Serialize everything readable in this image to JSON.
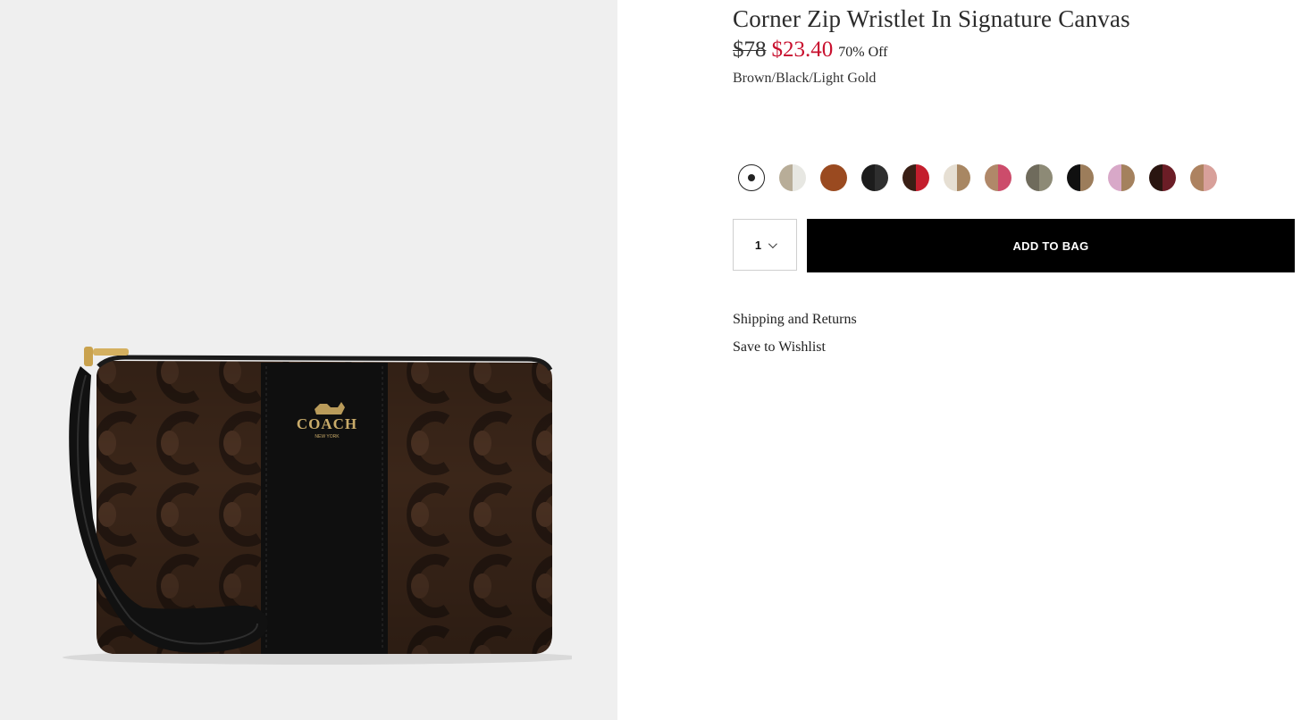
{
  "product": {
    "title": "Corner Zip Wristlet In Signature Canvas",
    "price_original": "$78",
    "price_sale": "$23.40",
    "discount": "70% Off",
    "color_name": "Brown/Black/Light Gold",
    "image_logo_text": "COACH",
    "image_logo_subtext": "NEW YORK"
  },
  "swatches": [
    {
      "name": "Brown/Black",
      "selected": true,
      "colors": [
        "#ffffff"
      ]
    },
    {
      "name": "swatch-2",
      "selected": false,
      "colors": [
        "#b8ad98",
        "#e7e7e2"
      ]
    },
    {
      "name": "swatch-3",
      "selected": false,
      "colors": [
        "#9a4a20",
        "#9a4a20"
      ]
    },
    {
      "name": "swatch-4",
      "selected": false,
      "colors": [
        "#1c1c1c",
        "#2f2f2f"
      ]
    },
    {
      "name": "swatch-5",
      "selected": false,
      "colors": [
        "#3a1f15",
        "#c41e2d"
      ]
    },
    {
      "name": "swatch-6",
      "selected": false,
      "colors": [
        "#e6dfd3",
        "#a88763"
      ]
    },
    {
      "name": "swatch-7",
      "selected": false,
      "colors": [
        "#b08869",
        "#cc4c6b"
      ]
    },
    {
      "name": "swatch-8",
      "selected": false,
      "colors": [
        "#6f6b5c",
        "#8d8a76"
      ]
    },
    {
      "name": "swatch-9",
      "selected": false,
      "colors": [
        "#101010",
        "#9c7d5b"
      ]
    },
    {
      "name": "swatch-10",
      "selected": false,
      "colors": [
        "#d8a8c8",
        "#a4815e"
      ]
    },
    {
      "name": "swatch-11",
      "selected": false,
      "colors": [
        "#2a1510",
        "#6b1d26"
      ]
    },
    {
      "name": "swatch-12",
      "selected": false,
      "colors": [
        "#ad8260",
        "#d8a09a"
      ]
    }
  ],
  "quantity": {
    "value": "1"
  },
  "buttons": {
    "add_to_bag": "ADD TO BAG"
  },
  "links": {
    "shipping_returns": "Shipping and Returns",
    "save_to_wishlist": "Save to Wishlist"
  }
}
